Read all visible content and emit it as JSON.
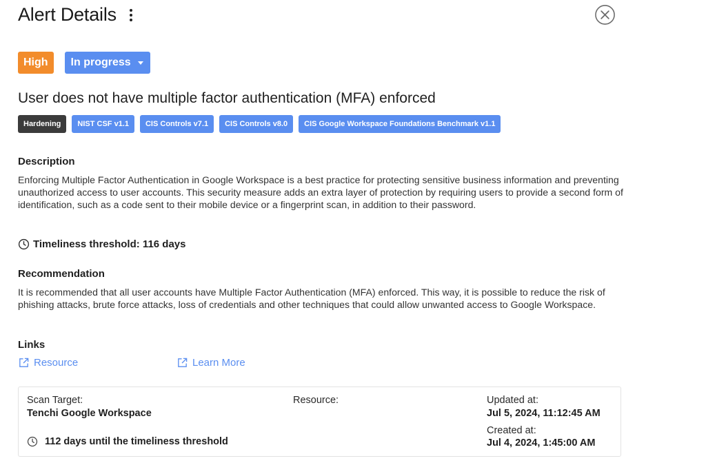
{
  "header": {
    "title": "Alert Details",
    "menu_icon": "kebab-menu-icon",
    "close_icon": "close-circle-icon"
  },
  "status": {
    "severity": "High",
    "severity_color": "#f28c2b",
    "state": "In progress",
    "state_color": "#5a8ef0"
  },
  "alert": {
    "title": "User does not have multiple factor authentication (MFA) enforced",
    "tags": [
      {
        "label": "Hardening",
        "color": "#3b3b3b"
      },
      {
        "label": "NIST CSF v1.1",
        "color": "#5a8ef0"
      },
      {
        "label": "CIS Controls v7.1",
        "color": "#5a8ef0"
      },
      {
        "label": "CIS Controls v8.0",
        "color": "#5a8ef0"
      },
      {
        "label": "CIS Google Workspace Foundations Benchmark v1.1",
        "color": "#5a8ef0"
      }
    ]
  },
  "description": {
    "heading": "Description",
    "text": "Enforcing Multiple Factor Authentication in Google Workspace is a best practice for protecting sensitive business information and preventing unauthorized access to user accounts. This security measure adds an extra layer of protection by requiring users to provide a second form of identification, such as a code sent to their mobile device or a fingerprint scan, in addition to their password."
  },
  "timeliness": {
    "label": "Timeliness threshold: 116 days",
    "icon": "clock-icon"
  },
  "recommendation": {
    "heading": "Recommendation",
    "text": "It is recommended that all user accounts have Multiple Factor Authentication (MFA) enforced. This way, it is possible to reduce the risk of phishing attacks, brute force attacks, loss of credentials and other techniques that could allow unwanted access to Google Workspace."
  },
  "links": {
    "heading": "Links",
    "items": [
      {
        "label": "Resource",
        "icon": "external-link-icon"
      },
      {
        "label": "Learn More",
        "icon": "external-link-icon"
      }
    ]
  },
  "card": {
    "scan_target_label": "Scan Target:",
    "scan_target_value": "Tenchi Google Workspace",
    "resource_label": "Resource:",
    "updated_label": "Updated at:",
    "updated_value": "Jul 5, 2024, 11:12:45 AM",
    "created_label": "Created at:",
    "created_value": "Jul 4, 2024, 1:45:00 AM",
    "timeliness_text": "112 days until the timeliness threshold"
  }
}
